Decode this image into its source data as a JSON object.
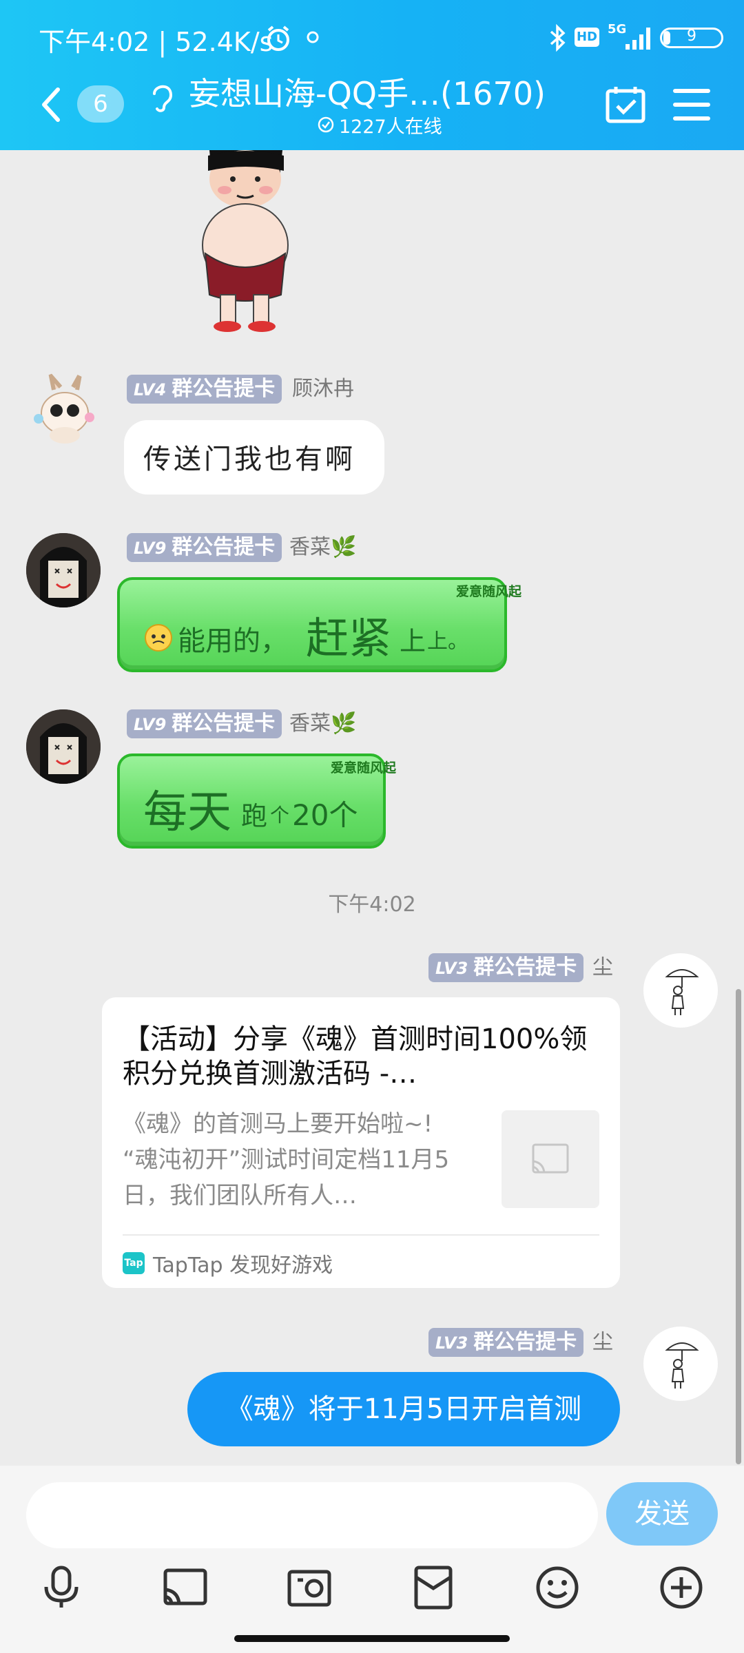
{
  "status_bar": {
    "time_speed": "下午4:02 | 52.4K/s",
    "battery": "9",
    "network": "5G"
  },
  "header": {
    "unread_count": "6",
    "title": "妄想山海-QQ手…(1670)",
    "online": "1227人在线"
  },
  "messages": {
    "m1": {
      "level": "LV4",
      "badge": "群公告提卡",
      "nick": "顾沐冉",
      "text": "传送门我也有啊"
    },
    "m2": {
      "level": "LV9",
      "badge": "群公告提卡",
      "nick": "香菜🌿",
      "tag": "爱意随风起",
      "t1": "能用的，",
      "t2": "赶紧",
      "t3": "上",
      "t4": "上。"
    },
    "m3": {
      "level": "LV9",
      "badge": "群公告提卡",
      "nick": "香菜🌿",
      "tag": "爱意随风起",
      "t1": "每天",
      "t2": "跑",
      "t3": "个",
      "t4": "20个"
    },
    "timestamp": "下午4:02",
    "m4": {
      "level": "LV3",
      "badge": "群公告提卡",
      "nick": "尘",
      "card_title": "【活动】分享《魂》首测时间100%领积分兑换首测激活码 -…",
      "card_desc": "《魂》的首测马上要开始啦~! “魂沌初开”测试时间定档11月5日，我们团队所有人…",
      "card_source": "TapTap 发现好游戏"
    },
    "m5": {
      "level": "LV3",
      "badge": "群公告提卡",
      "nick": "尘",
      "text": "《魂》将于11月5日开启首测"
    }
  },
  "input": {
    "send_label": "发送"
  },
  "toolbar": [
    "microphone-icon",
    "screen-share-icon",
    "photo-icon",
    "red-packet-icon",
    "emoji-icon",
    "plus-icon"
  ]
}
